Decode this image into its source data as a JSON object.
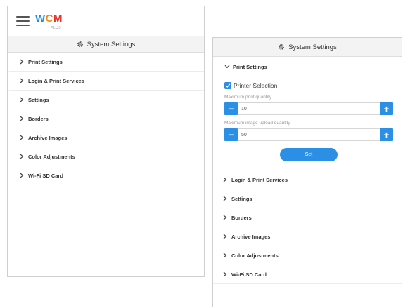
{
  "app": {
    "logo_text": [
      "W",
      "C",
      "M"
    ],
    "logo_sub": "PLUS",
    "colors": {
      "accent": "#2b8fe6",
      "logo_w": "#1a8fe3",
      "logo_c": "#f08a1c",
      "logo_m": "#e5322d"
    }
  },
  "left_panel": {
    "title": "System Settings",
    "items": [
      {
        "label": "Print Settings"
      },
      {
        "label": "Login & Print Services"
      },
      {
        "label": "Settings"
      },
      {
        "label": "Borders"
      },
      {
        "label": "Archive Images"
      },
      {
        "label": "Color Adjustments"
      },
      {
        "label": "Wi-Fi SD Card"
      }
    ]
  },
  "right_panel": {
    "title": "System Settings",
    "expanded_section": {
      "label": "Print Settings",
      "checkbox_label": "Printer Selection",
      "checked": true,
      "max_print_label": "Maximum print quantity",
      "max_print_value": "10",
      "max_upload_label": "Maximum image upload quantity",
      "max_upload_value": "50",
      "set_label": "Set"
    },
    "items": [
      {
        "label": "Login & Print Services"
      },
      {
        "label": "Settings"
      },
      {
        "label": "Borders"
      },
      {
        "label": "Archive Images"
      },
      {
        "label": "Color Adjustments"
      },
      {
        "label": "Wi-Fi SD Card"
      }
    ]
  },
  "icons": {
    "menu": "hamburger-icon",
    "gear": "gear-icon",
    "chevron_right": "chevron-right-icon",
    "chevron_down": "chevron-down-icon",
    "plus": "plus-icon",
    "minus": "minus-icon"
  },
  "glyphs": {
    "minus": "−",
    "plus": "+"
  }
}
